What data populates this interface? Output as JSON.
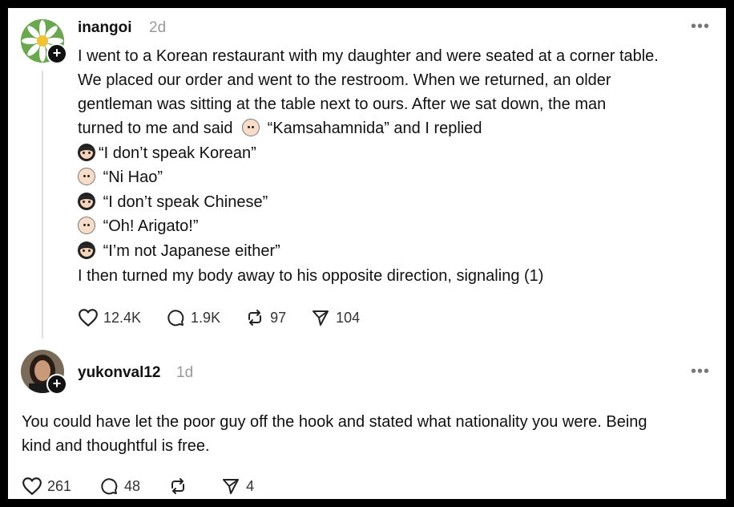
{
  "post1": {
    "username": "inangoi",
    "time": "2d",
    "more": "•••",
    "lines": [
      "I went to a Korean restaurant with my daughter and were seated at a corner table.",
      "We placed our order and went to the restroom. When we returned, an older",
      "gentleman was sitting at the table next to ours. After we sat down, the man",
      "turned to me and said",
      "“Kamsahamnida” and I replied",
      "“I don’t speak Korean”",
      "“Ni Hao”",
      "“I don’t speak Chinese”",
      "“Oh! Arigato!”",
      "“I’m not Japanese either”",
      "I then turned my body away to his opposite direction, signaling (1)"
    ],
    "likes": "12.4K",
    "comments": "1.9K",
    "reposts": "97",
    "shares": "104"
  },
  "post2": {
    "username": "yukonval12",
    "time": "1d",
    "more": "•••",
    "lines": [
      "You could have let the poor guy off the hook and stated what nationality you were. Being",
      "kind and thoughtful is free."
    ],
    "likes": "261",
    "comments": "48",
    "reposts": "",
    "shares": "4"
  },
  "icons": {
    "like": "heart-icon",
    "comment": "comment-icon",
    "repost": "repost-icon",
    "share": "share-icon"
  }
}
